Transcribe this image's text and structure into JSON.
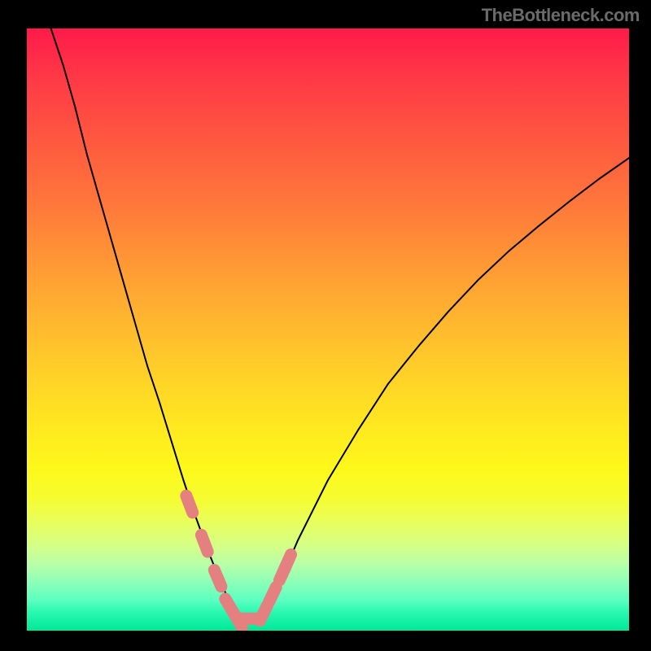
{
  "watermark": "TheBottleneck.com",
  "chart_data": {
    "type": "line",
    "title": "",
    "xlabel": "",
    "ylabel": "",
    "xlim": [
      0,
      100
    ],
    "ylim": [
      0,
      100
    ],
    "background_gradient": {
      "direction": "vertical",
      "stops": [
        {
          "pos": 0.0,
          "color": "#ff1a4a"
        },
        {
          "pos": 0.25,
          "color": "#ff7a3a"
        },
        {
          "pos": 0.5,
          "color": "#ffc72b"
        },
        {
          "pos": 0.73,
          "color": "#fdf81a"
        },
        {
          "pos": 0.86,
          "color": "#d4ff88"
        },
        {
          "pos": 1.0,
          "color": "#00e898"
        }
      ]
    },
    "series": [
      {
        "name": "v-curve",
        "stroke": "#000000",
        "stroke_width": 2.0,
        "x": [
          4,
          6,
          8,
          10,
          12,
          14,
          16,
          18,
          20,
          22,
          24,
          26,
          28,
          30,
          32,
          34,
          35.3,
          38.5,
          40,
          42,
          45,
          50,
          55,
          60,
          65,
          70,
          75,
          80,
          85,
          90,
          95,
          100
        ],
        "y": [
          100,
          94,
          87,
          79,
          72,
          65,
          58,
          51,
          44,
          38,
          31.5,
          25,
          19,
          13.5,
          8.5,
          4,
          2.0,
          2.0,
          3.7,
          8,
          15,
          25,
          33.3,
          41,
          47.2,
          53,
          58.3,
          63,
          67.2,
          71.2,
          75,
          78.5
        ]
      },
      {
        "name": "left-marker-points",
        "marker": "round-pill",
        "color": "#e58080",
        "x": [
          27.0,
          29.5,
          31.7,
          33.7,
          35.0
        ],
        "y": [
          21.0,
          14.5,
          8.7,
          4.0,
          1.8
        ]
      },
      {
        "name": "bottom-marker-segment",
        "marker": "round-pill",
        "color": "#e58080",
        "x": [
          35.3,
          38.5
        ],
        "y": [
          2.0,
          2.0
        ]
      },
      {
        "name": "right-marker-points",
        "marker": "round-pill",
        "color": "#e58080",
        "x": [
          39.3,
          40.8,
          42.5,
          43.3
        ],
        "y": [
          2.9,
          6.0,
          9.6,
          11.4
        ]
      }
    ],
    "annotations": []
  }
}
